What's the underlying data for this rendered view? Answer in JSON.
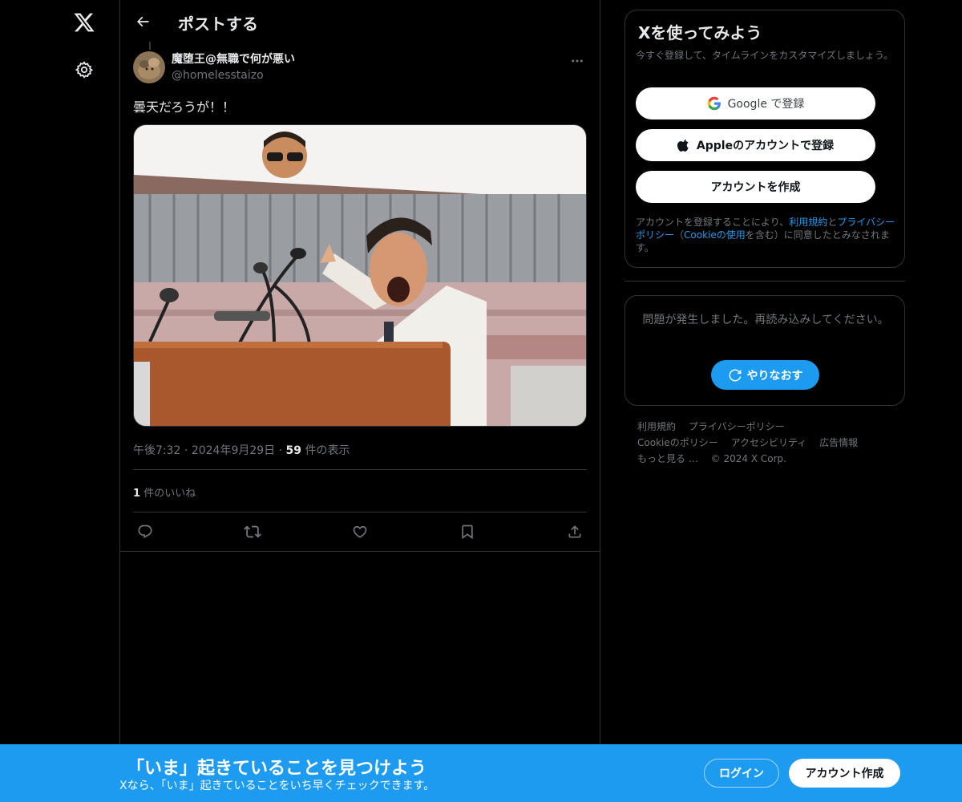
{
  "nav": {
    "logo_icon": "x-logo-icon",
    "settings_icon": "gear-icon"
  },
  "header": {
    "title": "ポストする",
    "back_icon": "arrow-left-icon"
  },
  "post": {
    "display_name": "魔堕王@無職で何が悪い",
    "handle": "@homelesstaizo",
    "text": "曇天だろうが！！",
    "time": "午後7:32",
    "date": "2024年9月29日",
    "view_count": "59",
    "view_label": "件の表示",
    "like_count": "1",
    "like_label": "件のいいね",
    "actions": [
      "reply-icon",
      "repost-icon",
      "like-icon",
      "bookmark-icon",
      "share-icon"
    ]
  },
  "signup": {
    "title": "Xを使ってみよう",
    "subtitle": "今すぐ登録して、タイムラインをカスタマイズしましょう。",
    "google_label": "Google で登録",
    "apple_label": "Appleのアカウントで登録",
    "create_label": "アカウントを作成",
    "legal_prefix": "アカウントを登録することにより、",
    "legal_terms": "利用規約",
    "legal_and": "と",
    "legal_privacy": "プライバシーポリシー",
    "legal_open": "（",
    "legal_cookie": "Cookieの使用",
    "legal_suffix": "を含む）に同意したとみなされます。"
  },
  "error": {
    "message": "問題が発生しました。再読み込みしてください。",
    "retry_label": "やりなおす"
  },
  "footer": {
    "links": [
      "利用規約",
      "プライバシーポリシー",
      "Cookieのポリシー",
      "アクセシビリティ",
      "広告情報",
      "もっと見る …",
      "© 2024 X Corp."
    ]
  },
  "banner": {
    "title": "「いま」起きていることを見つけよう",
    "subtitle": "Xなら、「いま」起きていることをいち早くチェックできます。",
    "login_label": "ログイン",
    "signup_label": "アカウント作成"
  },
  "colors": {
    "accent": "#1d9bf0",
    "background": "#000000",
    "border": "#2f3336",
    "muted": "#71767b"
  }
}
